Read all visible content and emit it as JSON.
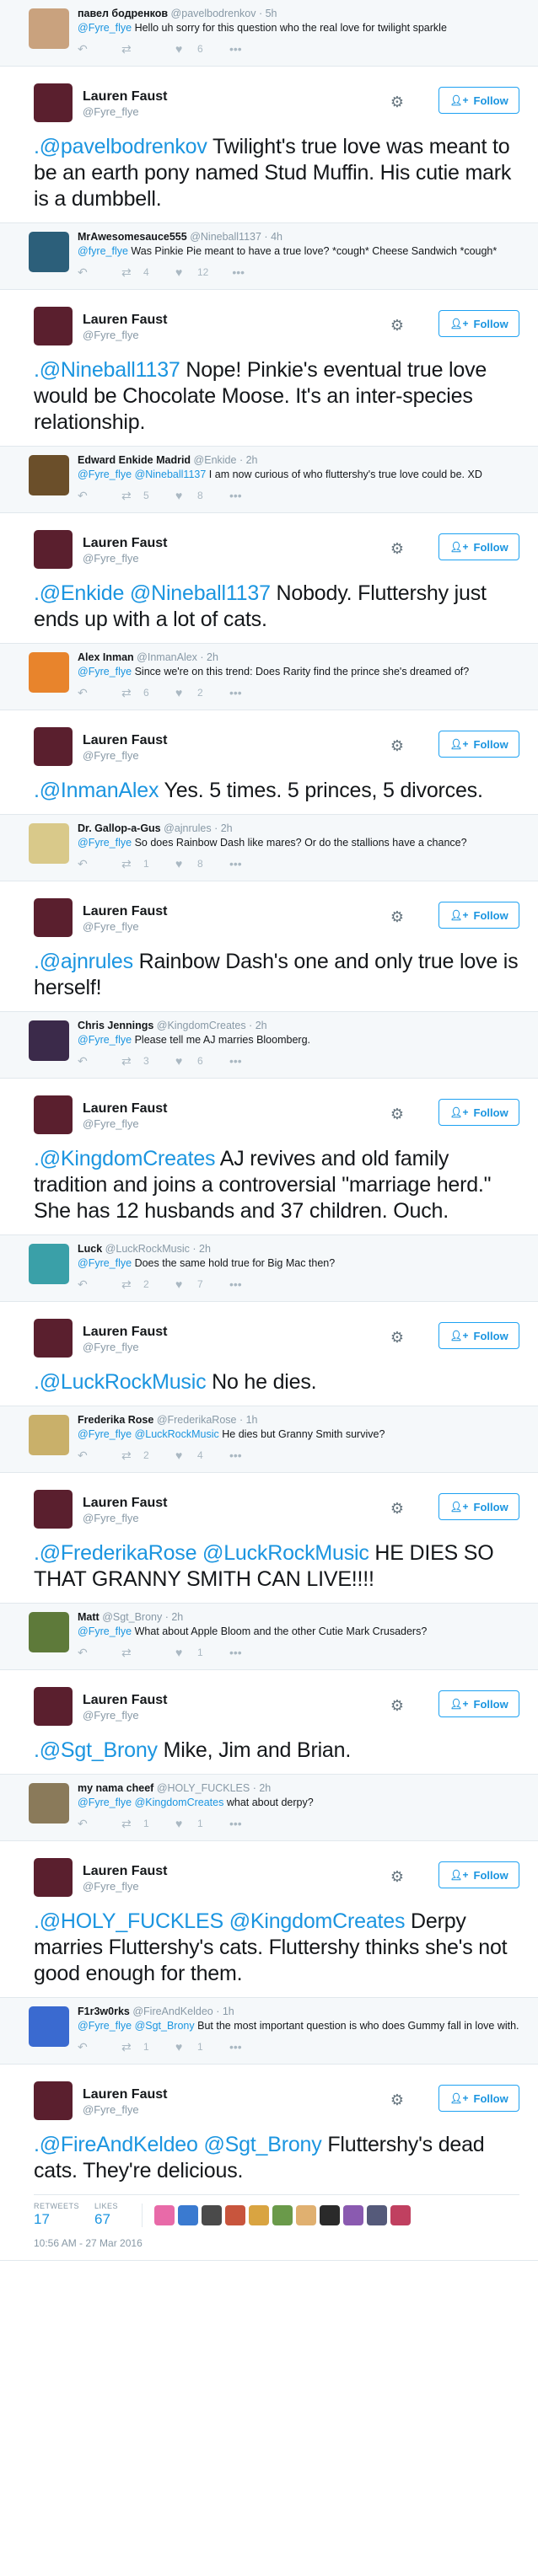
{
  "icons": {
    "reply": "reply-arrow-icon",
    "retweet": "retweet-icon",
    "like": "heart-icon",
    "more": "more-dots-icon",
    "settings": "gear-icon",
    "follow": "person-plus-icon"
  },
  "author": {
    "name": "Lauren Faust",
    "handle": "@Fyre_flye",
    "avatar_color": "#5a1f2e",
    "follow_label": "Follow"
  },
  "colors": {
    "link": "#1b95e0",
    "reply_background": "#f5f8fa",
    "meta_text": "#8899a6"
  },
  "replies": [
    {
      "name": "павел бодренков",
      "handle": "@pavelbodrenkov",
      "time": "5h",
      "mention": "@Fyre_flye",
      "text": "Hello uh sorry for this question who the real love for twilight sparkle",
      "retweets": "",
      "likes": "6",
      "avatar_color": "#c9a27e"
    },
    {
      "name": "MrAwesomesauce555",
      "handle": "@Nineball1137",
      "time": "4h",
      "mention": "@fyre_flye",
      "text": "Was Pinkie Pie meant to have a true love? *cough* Cheese Sandwich *cough*",
      "retweets": "4",
      "likes": "12",
      "avatar_color": "#2c5f7a"
    },
    {
      "name": "Edward Enkide Madrid",
      "handle": "@Enkide",
      "time": "2h",
      "mention": "@Fyre_flye @Nineball1137",
      "text": "I am now curious of who fluttershy's true love could be. XD",
      "retweets": "5",
      "likes": "8",
      "avatar_color": "#6b4f2a"
    },
    {
      "name": "Alex Inman",
      "handle": "@InmanAlex",
      "time": "2h",
      "mention": "@Fyre_flye",
      "text": "Since we're on this trend: Does Rarity find the prince she's dreamed of?",
      "retweets": "6",
      "likes": "2",
      "avatar_color": "#e8842c"
    },
    {
      "name": "Dr. Gallop-a-Gus",
      "handle": "@ajnrules",
      "time": "2h",
      "mention": "@Fyre_flye",
      "text": "So does Rainbow Dash like mares? Or do the stallions have a chance?",
      "retweets": "1",
      "likes": "8",
      "avatar_color": "#d9c98a"
    },
    {
      "name": "Chris Jennings",
      "handle": "@KingdomCreates",
      "time": "2h",
      "mention": "@Fyre_flye",
      "text": "Please tell me AJ marries Bloomberg.",
      "retweets": "3",
      "likes": "6",
      "avatar_color": "#3b2a4a"
    },
    {
      "name": "Luck",
      "handle": "@LuckRockMusic",
      "time": "2h",
      "mention": "@Fyre_flye",
      "text": "Does the same hold true for Big Mac then?",
      "retweets": "2",
      "likes": "7",
      "avatar_color": "#3aa0a8"
    },
    {
      "name": "Frederika Rose",
      "handle": "@FrederikaRose",
      "time": "1h",
      "mention": "@Fyre_flye @LuckRockMusic",
      "text": "He dies but Granny Smith survive?",
      "retweets": "2",
      "likes": "4",
      "avatar_color": "#c9b06a"
    },
    {
      "name": "Matt",
      "handle": "@Sgt_Brony",
      "time": "2h",
      "mention": "@Fyre_flye",
      "text": "What about Apple Bloom and the other Cutie Mark Crusaders?",
      "retweets": "",
      "likes": "1",
      "avatar_color": "#5e7a3a"
    },
    {
      "name": "my nama cheef",
      "handle": "@HOLY_FUCKLES",
      "time": "2h",
      "mention": "@Fyre_flye @KingdomCreates",
      "text": "what about derpy?",
      "retweets": "1",
      "likes": "1",
      "avatar_color": "#8a7a5a"
    },
    {
      "name": "F1r3w0rks",
      "handle": "@FireAndKeldeo",
      "time": "1h",
      "mention": "@Fyre_flye @Sgt_Brony",
      "text": "But the most important question is who does Gummy fall in love with.",
      "retweets": "1",
      "likes": "1",
      "avatar_color": "#3a6ad0"
    }
  ],
  "main_tweets": [
    {
      "mention": ".@pavelbodrenkov",
      "text": "Twilight's true love was meant to be an earth pony named Stud Muffin. His cutie mark is a dumbbell."
    },
    {
      "mention": ".@Nineball1137",
      "text": "Nope! Pinkie's eventual true love would be Chocolate Moose.  It's an inter-species relationship."
    },
    {
      "mention": ".@Enkide @Nineball1137",
      "text": "Nobody. Fluttershy just ends up with a lot of cats."
    },
    {
      "mention": ".@InmanAlex",
      "text": "Yes. 5 times. 5 princes, 5 divorces."
    },
    {
      "mention": ".@ajnrules",
      "text": "Rainbow Dash's one and only true love is herself!"
    },
    {
      "mention": ".@KingdomCreates",
      "text": "AJ revives and old family tradition and joins a controversial \"marriage herd.\" She has 12 husbands and 37 children. Ouch."
    },
    {
      "mention": ".@LuckRockMusic",
      "text": "No he dies."
    },
    {
      "mention": ".@FrederikaRose @LuckRockMusic",
      "text": "HE DIES SO THAT GRANNY SMITH CAN LIVE!!!!"
    },
    {
      "mention": ".@Sgt_Brony",
      "text": "Mike, Jim and Brian."
    },
    {
      "mention": ".@HOLY_FUCKLES @KingdomCreates",
      "text": "Derpy marries Fluttershy's cats. Fluttershy thinks she's not good enough for them."
    },
    {
      "mention": ".@FireAndKeldeo @Sgt_Brony",
      "text": "Fluttershy's dead cats. They're delicious."
    }
  ],
  "final": {
    "retweets_label": "RETWEETS",
    "retweets": "17",
    "likes_label": "LIKES",
    "likes": "67",
    "timestamp": "10:56 AM - 27 Mar 2016",
    "liker_colors": [
      "#e86aa8",
      "#3a7ad0",
      "#4a4a4a",
      "#c8553d",
      "#d9a441",
      "#6a9a4a",
      "#e0b070",
      "#2a2a2a",
      "#8a5ab0",
      "#555a7a",
      "#c04060"
    ]
  }
}
